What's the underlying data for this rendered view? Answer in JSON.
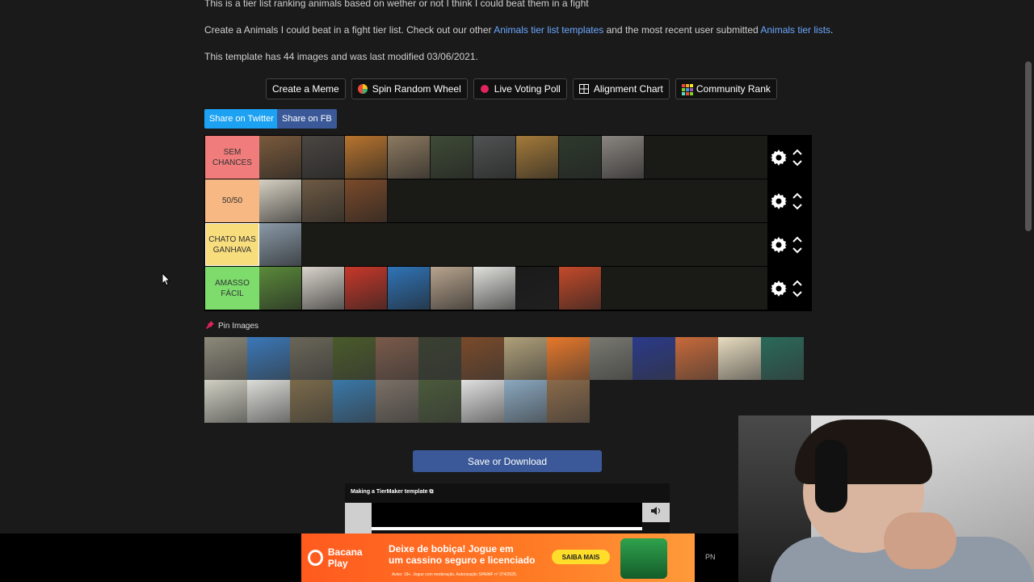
{
  "intro": {
    "line1": "This is a tier list ranking animals based on wether or not I think I could beat them in a fight",
    "line2_pre": "Create a Animals I could beat in a fight tier list. Check out our other ",
    "line2_link1": "Animals tier list templates",
    "line2_mid": " and the most recent user submitted ",
    "line2_link2": "Animals tier lists",
    "line2_post": ".",
    "line3": "This template has 44 images and was last modified 03/06/2021."
  },
  "toolbar": {
    "create_meme": "Create a Meme",
    "spin_wheel": "Spin Random Wheel",
    "live_poll": "Live Voting Poll",
    "alignment": "Alignment Chart",
    "community": "Community Rank"
  },
  "share": {
    "twitter": "Share on Twitter",
    "fb": "Share on FB"
  },
  "tiers": [
    {
      "label": "SEM CHANCES",
      "color": "#f07c7c",
      "items": [
        "#7a5a3c",
        "#4a4642",
        "#b8742e",
        "#8c7a60",
        "#3f4b36",
        "#505353",
        "#a47a3a",
        "#2e3a2c",
        "#8a8580"
      ]
    },
    {
      "label": "50/50",
      "color": "#f7b883",
      "items": [
        "#d6d0c2",
        "#6e5a44",
        "#7a4a2a"
      ]
    },
    {
      "label": "CHATO MAS GANHAVA",
      "color": "#f8dd7d",
      "items": [
        "#8a9aa8"
      ]
    },
    {
      "label": "AMASSO FÁCIL",
      "color": "#7ddc6c",
      "items": [
        "#5a8a3a",
        "#d9d4cc",
        "#c8382a",
        "#2f74b8",
        "#b8a48e",
        "#e0e0dc",
        "#1a1a1a",
        "#c44a2a"
      ]
    }
  ],
  "pin_label": "Pin Images",
  "pool": [
    "#8d8a7a",
    "#3a78b8",
    "#6a6658",
    "#4a5a2a",
    "#7a5a4a",
    "#3a4032",
    "#7a4a2a",
    "#b0a07a",
    "#e8782a",
    "#7a7a72",
    "#2a3a8a",
    "#c86a3a",
    "#e8dcc0",
    "#2a6a5a",
    "#cfcfc2",
    "#dcdcd8",
    "#7a6a4a",
    "#3a78a8",
    "#7a7066",
    "#4a5a3a",
    "#e0e0e0",
    "#8aa8c0",
    "#8a6a4a"
  ],
  "save_label": "Save or Download",
  "video": {
    "title": "Making a TierMaker template"
  },
  "ad": {
    "brand": "Bacana Play",
    "headline1": "Deixe de bobiça! Jogue em",
    "headline2": "um cassino seguro e licenciado",
    "fine": "Aviso: 18+. Jogue com moderação. Autorização SPA/MF nº 374/2025.",
    "cta": "SAIBA MAIS"
  },
  "pn": "PN"
}
